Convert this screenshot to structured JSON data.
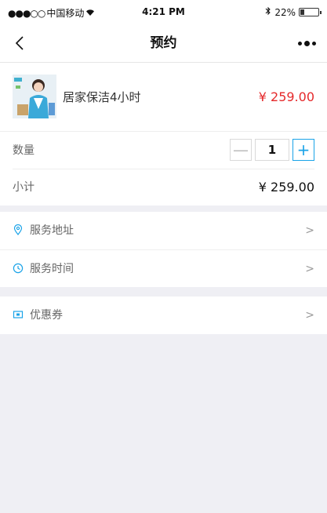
{
  "status_bar": {
    "carrier": "中国移动",
    "time": "4:21 PM",
    "battery": "22%",
    "battery_level": 0.22
  },
  "nav": {
    "title": "预约",
    "back_icon": "chevron-left-icon",
    "more_icon": "more-dots-icon"
  },
  "product": {
    "name": "居家保洁4小时",
    "price": "¥ 259.00"
  },
  "quantity": {
    "label": "数量",
    "value": "1",
    "minus": "—",
    "plus": "+"
  },
  "subtotal": {
    "label": "小计",
    "value": "¥ 259.00"
  },
  "options": [
    {
      "label": "服务地址",
      "icon": "location-pin-icon",
      "chevron": ">"
    },
    {
      "label": "服务时间",
      "icon": "clock-icon",
      "chevron": ">"
    }
  ],
  "coupon": {
    "label": "优惠券",
    "icon": "coupon-icon",
    "chevron": ">"
  },
  "colors": {
    "accent": "#1aa3e8",
    "price_red": "#e5292b",
    "background": "#efeff4"
  }
}
